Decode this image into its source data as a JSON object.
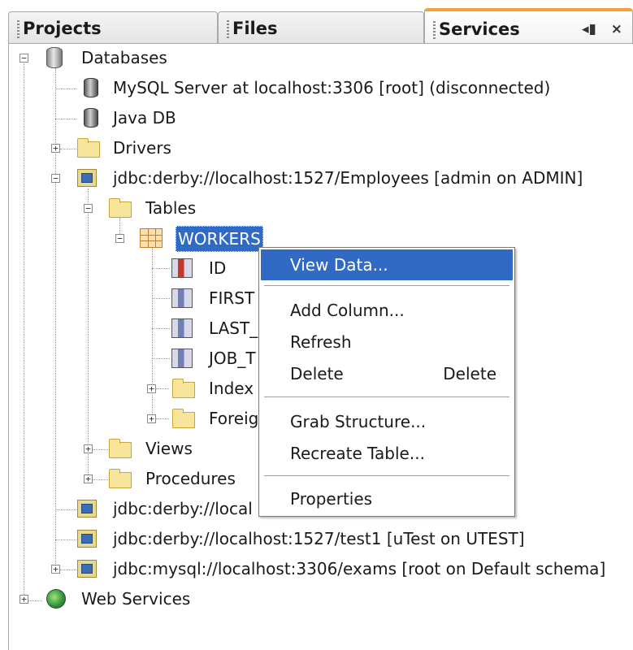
{
  "tabs": {
    "projects": "Projects",
    "files": "Files",
    "services": "Services",
    "restore_glyph": "◂▮",
    "close_glyph": "×"
  },
  "tree": {
    "databases": "Databases",
    "mysql_server": "MySQL Server at localhost:3306 [root] (disconnected)",
    "java_db": "Java DB",
    "drivers": "Drivers",
    "conn_employees": "jdbc:derby://localhost:1527/Employees [admin on ADMIN]",
    "tables": "Tables",
    "workers": "WORKERS",
    "col_id": "ID",
    "col_first": "FIRST",
    "col_last": "LAST_",
    "col_job": "JOB_T",
    "indexes": "Index",
    "foreign": "Foreig",
    "views": "Views",
    "procedures": "Procedures",
    "conn_local": "jdbc:derby://local",
    "conn_test1": "jdbc:derby://localhost:1527/test1 [uTest on UTEST]",
    "conn_exams": "jdbc:mysql://localhost:3306/exams [root on Default schema]",
    "web_services": "Web Services"
  },
  "context_menu": {
    "view_data": "View Data...",
    "add_column": "Add Column...",
    "refresh": "Refresh",
    "delete": "Delete",
    "delete_shortcut": "Delete",
    "grab_structure": "Grab Structure...",
    "recreate_table": "Recreate Table...",
    "properties": "Properties"
  },
  "colors": {
    "selection": "#316ac5",
    "active_tab_accent": "#f2a23a"
  }
}
